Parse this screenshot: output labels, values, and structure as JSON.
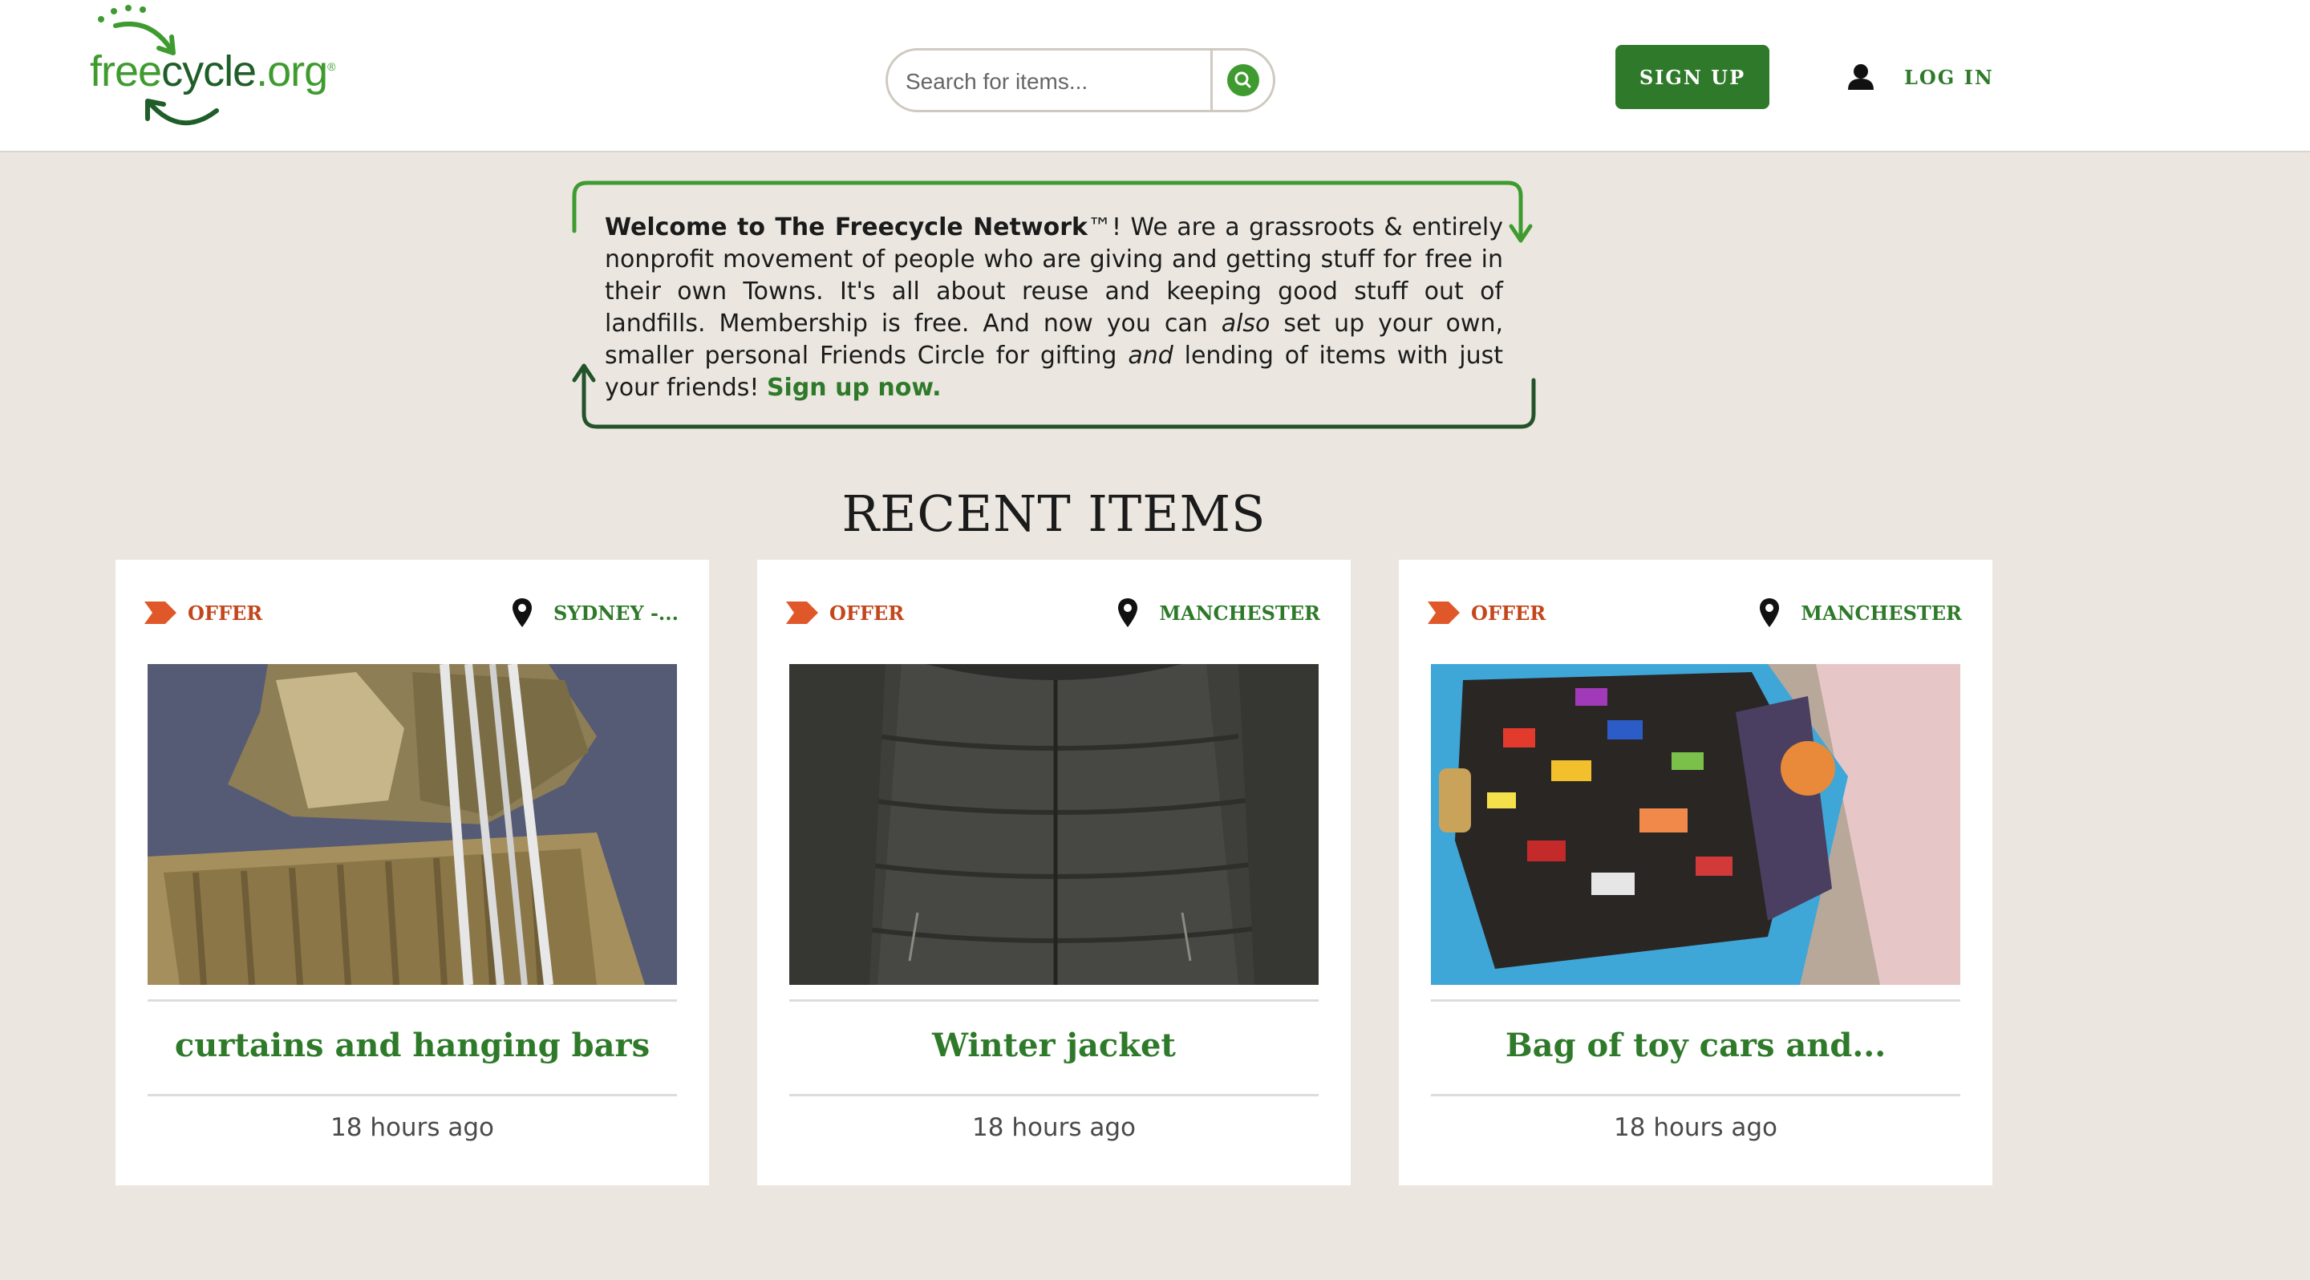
{
  "header": {
    "logo": {
      "free": "free",
      "cycle": "cycle",
      "org": ".org",
      "reg": "®"
    },
    "search": {
      "placeholder": "Search for items..."
    },
    "signup_label": "SIGN UP",
    "login_label": "LOG IN"
  },
  "welcome": {
    "intro_bold": "Welcome to The Freecycle Network",
    "tm": "™",
    "part1": "! We are a grassroots & entirely nonprofit movement of people who are giving and getting stuff for free in their own Towns. It's all about reuse and keeping good stuff out of landfills. Membership is free. And now you can ",
    "also": "also",
    "part2": " set up your own, smaller personal Friends Circle for gifting ",
    "and": "and",
    "part3": " lending of items with just your friends! ",
    "signup_link": "Sign up now."
  },
  "recent": {
    "title": "RECENT ITEMS",
    "items": [
      {
        "type": "OFFER",
        "location": "SYDNEY -...",
        "title": "curtains and hanging bars",
        "time": "18 hours ago"
      },
      {
        "type": "OFFER",
        "location": "MANCHESTER",
        "title": "Winter jacket",
        "time": "18 hours ago"
      },
      {
        "type": "OFFER",
        "location": "MANCHESTER",
        "title": "Bag of toy cars and...",
        "time": "18 hours ago"
      }
    ]
  },
  "colors": {
    "brand_green": "#2f7a2a",
    "light_green": "#3f9b2f",
    "offer_orange": "#c4461b",
    "page_bg": "#ebe7e0"
  },
  "icons": [
    "logo-arrows-icon",
    "search-icon",
    "user-icon",
    "offer-chevron-icon",
    "location-pin-icon"
  ]
}
